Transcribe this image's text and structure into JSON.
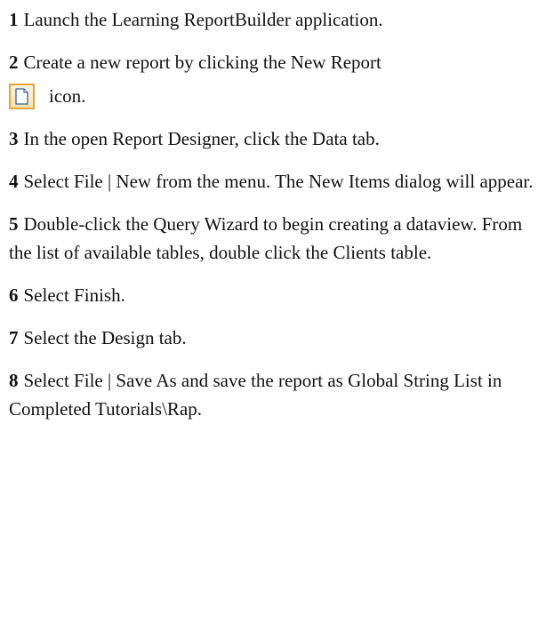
{
  "steps": [
    {
      "num": "1",
      "text": "Launch the Learning ReportBuilder application."
    },
    {
      "num": "2",
      "text": "Create a new report by clicking the New Report",
      "after_icon": "icon.",
      "icon": "new-report-icon"
    },
    {
      "num": "3",
      "text": "In the open Report Designer, click the Data tab."
    },
    {
      "num": "4",
      "text": "Select File | New from the menu.  The New Items dialog will appear."
    },
    {
      "num": "5",
      "text": "Double-click the Query Wizard to begin creating a dataview.  From the list of available tables, double click the Clients table."
    },
    {
      "num": "6",
      "text": "Select Finish."
    },
    {
      "num": "7",
      "text": "Select the Design tab."
    },
    {
      "num": "8",
      "text": "Select File | Save As and save the report as Global String List in Completed Tutorials\\Rap."
    }
  ]
}
